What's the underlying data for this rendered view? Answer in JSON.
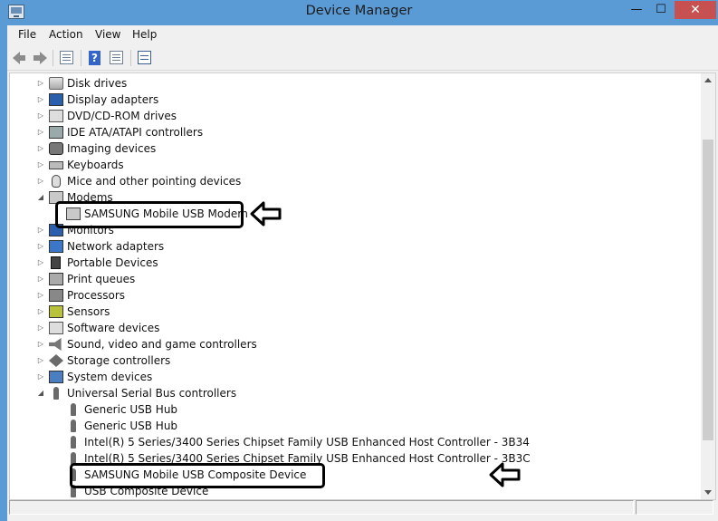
{
  "window": {
    "title": "Device Manager",
    "controls": {
      "minimize": "—",
      "maximize": "☐",
      "close": "✕"
    }
  },
  "menubar": {
    "items": [
      "File",
      "Action",
      "View",
      "Help"
    ]
  },
  "toolbar": {
    "buttons": [
      "back-icon",
      "forward-icon",
      "properties-view-icon",
      "help-icon",
      "update-driver-icon",
      "scan-hardware-icon"
    ]
  },
  "tree": {
    "rows": [
      {
        "label": "Disk drives",
        "state": "collapsed",
        "icon": "disk-drive-icon"
      },
      {
        "label": "Display adapters",
        "state": "collapsed",
        "icon": "display-adapter-icon"
      },
      {
        "label": "DVD/CD-ROM drives",
        "state": "collapsed",
        "icon": "dvd-drive-icon"
      },
      {
        "label": "IDE ATA/ATAPI controllers",
        "state": "collapsed",
        "icon": "ide-controller-icon"
      },
      {
        "label": "Imaging devices",
        "state": "collapsed",
        "icon": "camera-icon"
      },
      {
        "label": "Keyboards",
        "state": "collapsed",
        "icon": "keyboard-icon"
      },
      {
        "label": "Mice and other pointing devices",
        "state": "collapsed",
        "icon": "mouse-icon"
      },
      {
        "label": "Modems",
        "state": "expanded",
        "icon": "modem-icon"
      },
      {
        "label": "SAMSUNG Mobile USB Modem",
        "state": "child",
        "icon": "modem-icon"
      },
      {
        "label": "Monitors",
        "state": "collapsed",
        "icon": "monitor-icon"
      },
      {
        "label": "Network adapters",
        "state": "collapsed",
        "icon": "network-adapter-icon"
      },
      {
        "label": "Portable Devices",
        "state": "collapsed",
        "icon": "portable-device-icon"
      },
      {
        "label": "Print queues",
        "state": "collapsed",
        "icon": "printer-icon"
      },
      {
        "label": "Processors",
        "state": "collapsed",
        "icon": "processor-icon"
      },
      {
        "label": "Sensors",
        "state": "collapsed",
        "icon": "sensor-icon"
      },
      {
        "label": "Software devices",
        "state": "collapsed",
        "icon": "software-device-icon"
      },
      {
        "label": "Sound, video and game controllers",
        "state": "collapsed",
        "icon": "speaker-icon"
      },
      {
        "label": "Storage controllers",
        "state": "collapsed",
        "icon": "storage-controller-icon"
      },
      {
        "label": "System devices",
        "state": "collapsed",
        "icon": "system-device-icon"
      },
      {
        "label": "Universal Serial Bus controllers",
        "state": "expanded",
        "icon": "usb-icon"
      },
      {
        "label": "Generic USB Hub",
        "state": "child",
        "icon": "usb-icon"
      },
      {
        "label": "Generic USB Hub",
        "state": "child",
        "icon": "usb-icon"
      },
      {
        "label": "Intel(R) 5 Series/3400 Series Chipset Family USB Enhanced Host Controller - 3B34",
        "state": "child",
        "icon": "usb-icon"
      },
      {
        "label": "Intel(R) 5 Series/3400 Series Chipset Family USB Enhanced Host Controller - 3B3C",
        "state": "child",
        "icon": "usb-icon"
      },
      {
        "label": "SAMSUNG Mobile USB Composite Device",
        "state": "child",
        "icon": "usb-icon"
      },
      {
        "label": "USB Composite Device",
        "state": "child",
        "icon": "usb-icon"
      }
    ]
  },
  "glyphs": {
    "collapsed": "▷",
    "expanded": "◢"
  },
  "annotations": {
    "color": "#000000"
  }
}
